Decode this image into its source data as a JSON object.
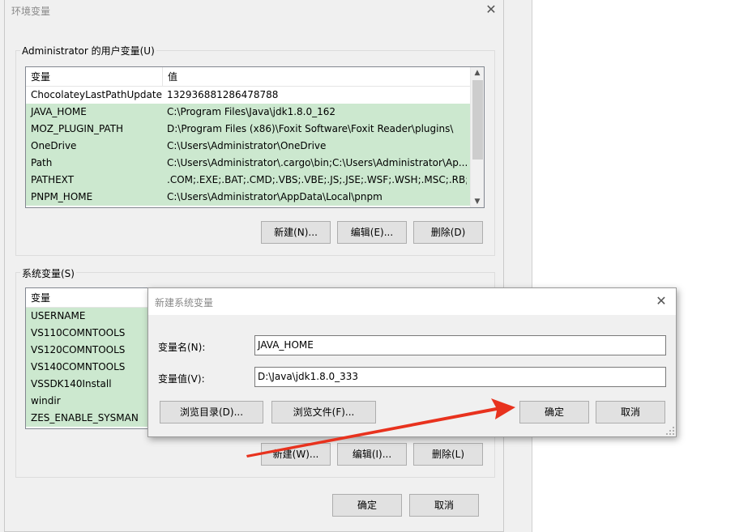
{
  "env_dialog": {
    "title": "环境变量",
    "close_glyph": "✕",
    "user_group_label": "Administrator 的用户变量(U)",
    "user_columns": [
      "变量",
      "值"
    ],
    "user_rows": [
      {
        "name": "ChocolateyLastPathUpdate",
        "value": "132936881286478788"
      },
      {
        "name": "JAVA_HOME",
        "value": "C:\\Program Files\\Java\\jdk1.8.0_162"
      },
      {
        "name": "MOZ_PLUGIN_PATH",
        "value": "D:\\Program Files (x86)\\Foxit Software\\Foxit Reader\\plugins\\"
      },
      {
        "name": "OneDrive",
        "value": "C:\\Users\\Administrator\\OneDrive"
      },
      {
        "name": "Path",
        "value": "C:\\Users\\Administrator\\.cargo\\bin;C:\\Users\\Administrator\\Ap..."
      },
      {
        "name": "PATHEXT",
        "value": ".COM;.EXE;.BAT;.CMD;.VBS;.VBE;.JS;.JSE;.WSF;.WSH;.MSC;.RB;...."
      },
      {
        "name": "PNPM_HOME",
        "value": "C:\\Users\\Administrator\\AppData\\Local\\pnpm"
      }
    ],
    "user_buttons": {
      "new": "新建(N)...",
      "edit": "编辑(E)...",
      "delete": "删除(D)"
    },
    "system_group_label": "系统变量(S)",
    "system_columns": [
      "变量"
    ],
    "system_rows": [
      {
        "name": "USERNAME"
      },
      {
        "name": "VS110COMNTOOLS"
      },
      {
        "name": "VS120COMNTOOLS"
      },
      {
        "name": "VS140COMNTOOLS"
      },
      {
        "name": "VSSDK140Install"
      },
      {
        "name": "windir"
      },
      {
        "name": "ZES_ENABLE_SYSMAN"
      }
    ],
    "system_buttons": {
      "new": "新建(W)...",
      "edit": "编辑(I)...",
      "delete": "删除(L)"
    },
    "ok_label": "确定",
    "cancel_label": "取消"
  },
  "new_var_dialog": {
    "title": "新建系统变量",
    "close_glyph": "✕",
    "name_label": "变量名(N):",
    "name_value": "JAVA_HOME",
    "value_label": "变量值(V):",
    "value_value": "D:\\Java\\jdk1.8.0_333",
    "browse_dir_label": "浏览目录(D)...",
    "browse_file_label": "浏览文件(F)...",
    "ok_label": "确定",
    "cancel_label": "取消"
  },
  "annotation": {
    "arrow_color": "#e8321e"
  },
  "colors": {
    "selection": "#cce8cf",
    "dialog_bg": "#f0f0f0",
    "button_bg": "#e1e1e1"
  }
}
